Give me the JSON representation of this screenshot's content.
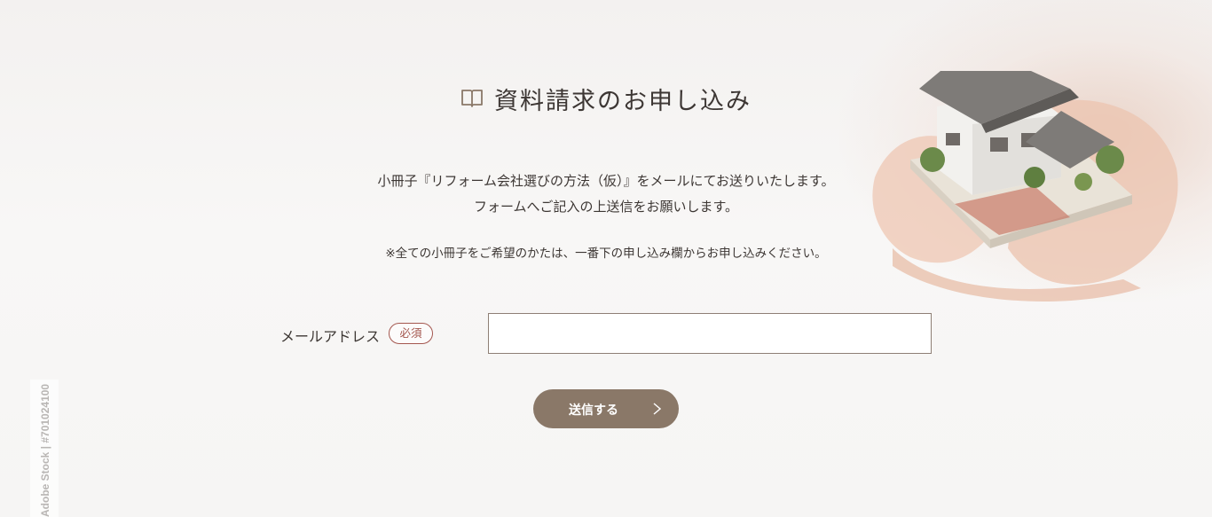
{
  "header": {
    "title": "資料請求のお申し込み",
    "icon": "book-icon"
  },
  "intro": {
    "line1": "小冊子『リフォーム会社選びの方法（仮）』をメールにてお送りいたします。",
    "line2": "フォームへご記入の上送信をお願いします。"
  },
  "note": "※全ての小冊子をご希望のかたは、一番下の申し込み欄からお申し込みください。",
  "form": {
    "email_label": "メールアドレス",
    "required_badge": "必須",
    "email_value": "",
    "submit_label": "送信する",
    "submit_icon": "chevron-right-icon"
  },
  "watermark": "Adobe Stock | #701024100",
  "colors": {
    "accent": "#8a7868",
    "required": "#a4574f",
    "text": "#3d3734"
  }
}
